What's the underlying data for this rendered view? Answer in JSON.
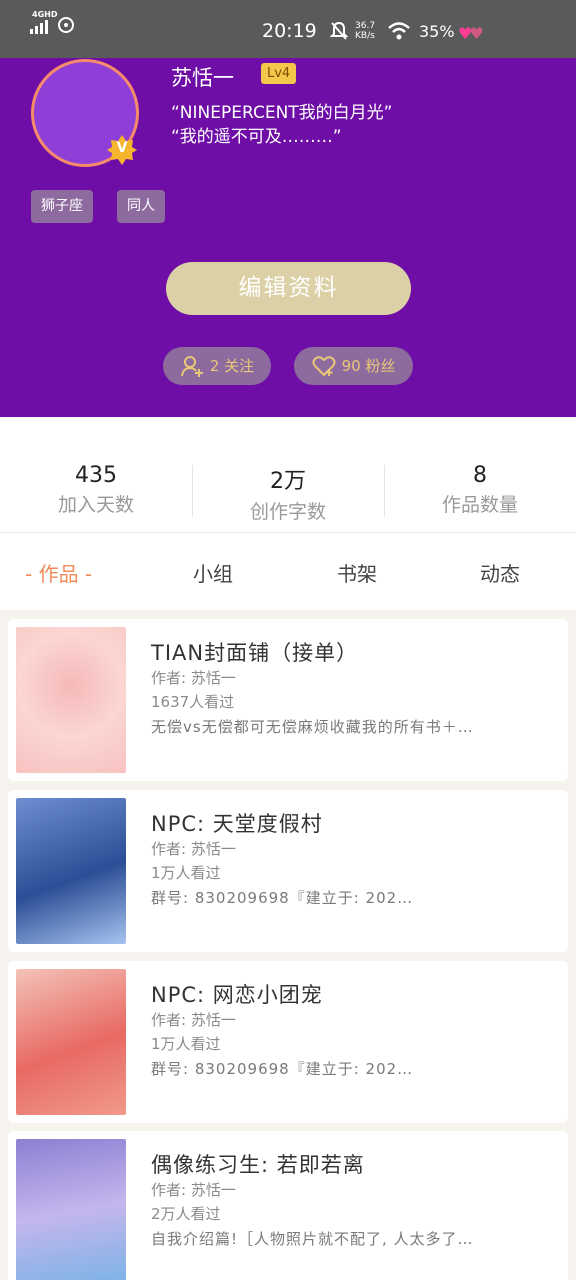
{
  "status_bar": {
    "network": "4GHD",
    "time": "20:19",
    "net_speed": "36.7",
    "net_unit": "KB/s",
    "battery": "35%"
  },
  "profile": {
    "name": "苏恬一",
    "level": "Lv4",
    "signature_line1": "“NINEPERCENT我的白月光”",
    "signature_line2": "“我的遥不可及………”",
    "tags": [
      "狮子座",
      "同人"
    ],
    "edit_button": "编辑资料",
    "following": "2 关注",
    "followers": "90 粉丝"
  },
  "stats": [
    {
      "value": "435",
      "label": "加入天数"
    },
    {
      "value": "2万",
      "label": "创作字数"
    },
    {
      "value": "8",
      "label": "作品数量"
    }
  ],
  "tabs": [
    "- 作品 -",
    "小组",
    "书架",
    "动态"
  ],
  "works": [
    {
      "title": "TIAN封面铺（接单）",
      "author": "作者: 苏恬一",
      "views": "1637人看过",
      "desc": "无偿vs无偿都可无偿麻烦收藏我的所有书＋…"
    },
    {
      "title": "NPC: 天堂度假村",
      "author": "作者: 苏恬一",
      "views": "1万人看过",
      "desc": "群号: 830209698『建立于: 202…"
    },
    {
      "title": "NPC: 网恋小团宠",
      "author": "作者: 苏恬一",
      "views": "1万人看过",
      "desc": "群号: 830209698『建立于: 202…"
    },
    {
      "title": "偶像练习生: 若即若离",
      "author": "作者: 苏恬一",
      "views": "2万人看过",
      "desc": "自我介绍篇!［人物照片就不配了, 人太多了…"
    }
  ],
  "colors": {
    "header": "#6f0ea6",
    "accent": "#f08a5a",
    "level_badge": "#f4c74a",
    "edit_button": "#dcd0a7"
  }
}
